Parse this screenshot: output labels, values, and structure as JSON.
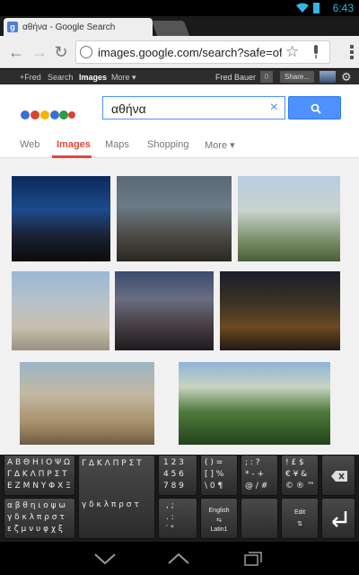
{
  "status": {
    "time": "6:43"
  },
  "tab": {
    "favicon": "g",
    "title": "αθήνα - Google Search"
  },
  "address": {
    "url": "images.google.com/search?safe=off&biw=601!"
  },
  "gbar": {
    "items": [
      "+Fred",
      "Search",
      "Images",
      "More ▾"
    ],
    "user": "Fred Bauer",
    "notifications": "0",
    "share": "Share..."
  },
  "search": {
    "query": "αθήνα",
    "clear": "×"
  },
  "tabs": [
    "Web",
    "Images",
    "Maps",
    "Shopping",
    "More ▾"
  ],
  "images": [
    {
      "style": "night"
    },
    {
      "style": "dusk"
    },
    {
      "style": "day"
    },
    {
      "style": "city"
    },
    {
      "style": "eve"
    },
    {
      "style": "hill"
    },
    {
      "style": "ruins"
    },
    {
      "style": "green"
    }
  ],
  "keyboard": {
    "greek_upper": [
      "Α Β Θ Η Ι Ο Ψ Ω",
      "Γ Δ Κ Λ Π Ρ Σ Τ",
      "Ε Ζ Μ Ν Υ Φ Χ Ξ"
    ],
    "greek_lower": [
      "α β θ η ι ο ψ ω",
      "γ δ κ λ π ρ σ τ",
      "ε ζ μ ν υ φ χ ξ"
    ],
    "numbers": [
      "1 2 3",
      "4 5 6",
      "7 8 9"
    ],
    "symbols_1": [
      "( ) =",
      "[ ] %",
      "\\ 0 ¶"
    ],
    "symbols_2": [
      "; : ?",
      "* - +",
      "@ / #"
    ],
    "symbols_3": [
      "! £ $",
      "€ ¥ &",
      "© ® ™"
    ],
    "punct": [
      ", ;",
      ". :",
      "′ \""
    ],
    "lang_labels": [
      "English",
      "Latin1"
    ],
    "edit_label": "Edit"
  },
  "colors": {
    "accent_blue": "#4d90fe",
    "images_red": "#dd4b39",
    "status_blue": "#33b5e5"
  },
  "icons": {
    "back": "back-icon",
    "forward": "forward-icon",
    "reload": "reload-icon",
    "globe": "globe-icon",
    "star": "star-icon",
    "mic": "mic-icon",
    "menu": "overflow-menu-icon",
    "settings": "gear-icon",
    "wifi": "wifi-icon",
    "battery": "battery-icon"
  }
}
